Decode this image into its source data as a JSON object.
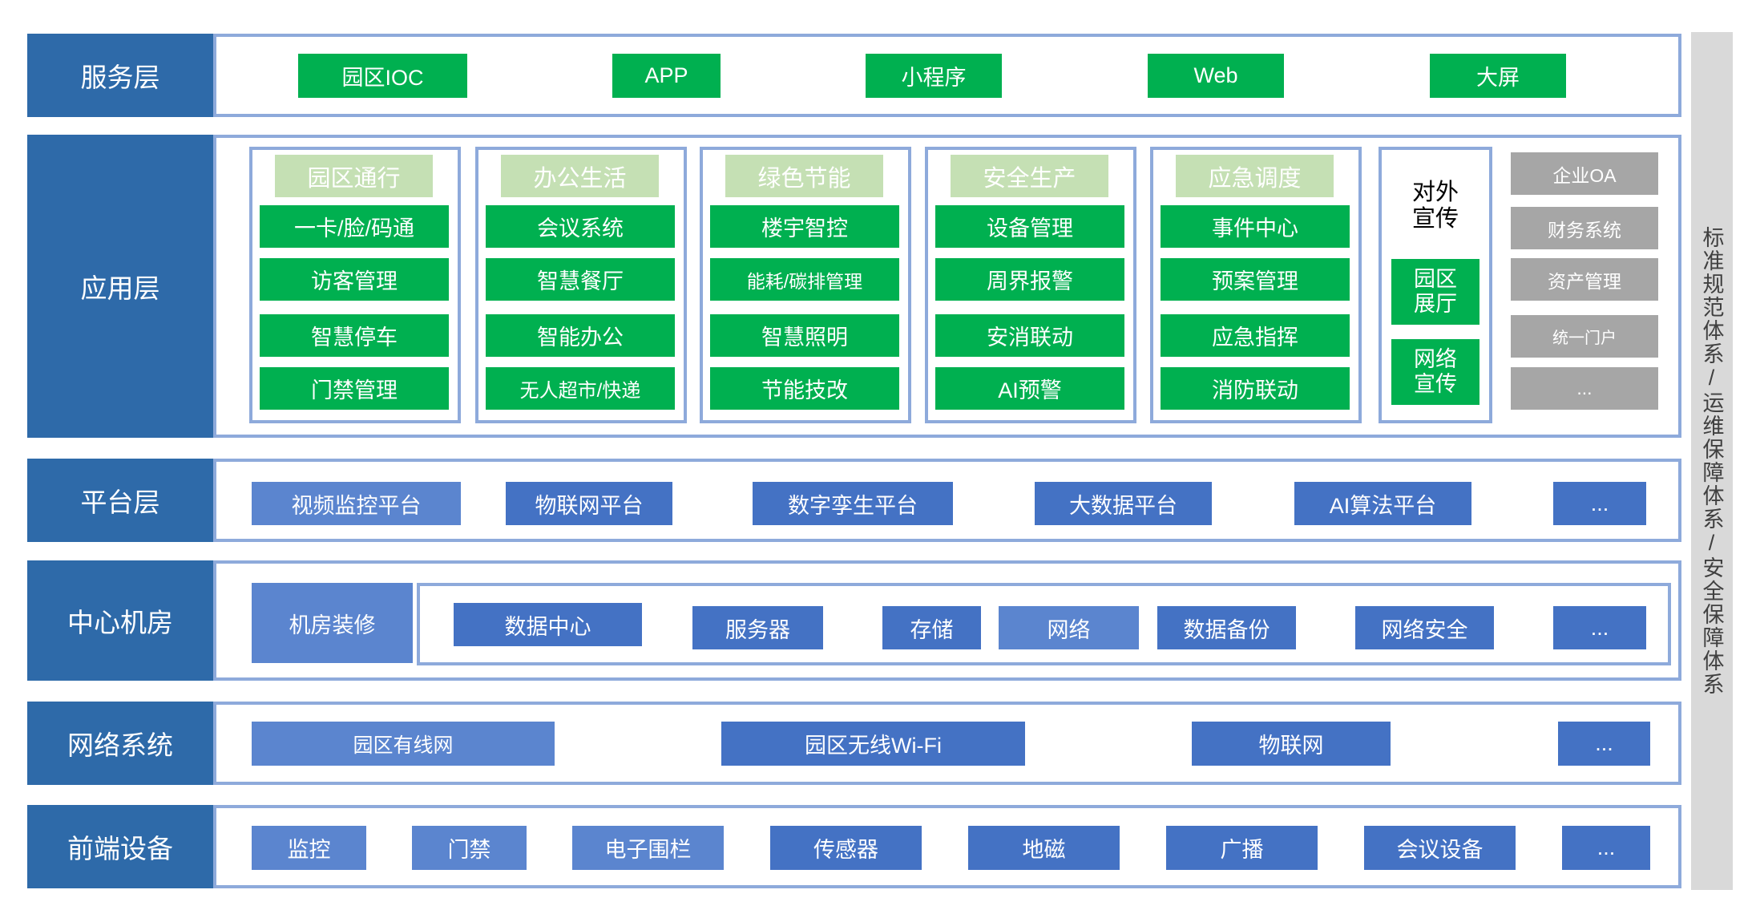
{
  "layers": {
    "service": "服务层",
    "application": "应用层",
    "platform": "平台层",
    "datacenter": "中心机房",
    "network": "网络系统",
    "frontend": "前端设备"
  },
  "service": [
    "园区IOC",
    "APP",
    "小程序",
    "Web",
    "大屏"
  ],
  "app_columns": [
    {
      "title": "园区通行",
      "items": [
        "一卡/脸/码通",
        "访客管理",
        "智慧停车",
        "门禁管理"
      ]
    },
    {
      "title": "办公生活",
      "items": [
        "会议系统",
        "智慧餐厅",
        "智能办公",
        "无人超市/快递"
      ]
    },
    {
      "title": "绿色节能",
      "items": [
        "楼宇智控",
        "能耗/碳排管理",
        "智慧照明",
        "节能技改"
      ]
    },
    {
      "title": "安全生产",
      "items": [
        "设备管理",
        "周界报警",
        "安消联动",
        "AI预警"
      ]
    },
    {
      "title": "应急调度",
      "items": [
        "事件中心",
        "预案管理",
        "应急指挥",
        "消防联动"
      ]
    }
  ],
  "publicity": {
    "title": "对外宣传",
    "items": [
      "园区展厅",
      "网络宣传"
    ]
  },
  "enterprise": [
    "企业OA",
    "财务系统",
    "资产管理",
    "统一门户",
    "..."
  ],
  "platform": [
    "视频监控平台",
    "物联网平台",
    "数字孪生平台",
    "大数据平台",
    "AI算法平台",
    "..."
  ],
  "datacenter": {
    "decoration": "机房装修",
    "items": [
      "数据中心",
      "服务器",
      "存储",
      "网络",
      "数据备份",
      "网络安全",
      "..."
    ]
  },
  "network": [
    "园区有线网",
    "园区无线Wi-Fi",
    "物联网",
    "..."
  ],
  "frontend": [
    "监控",
    "门禁",
    "电子围栏",
    "传感器",
    "地磁",
    "广播",
    "会议设备",
    "..."
  ],
  "side": "标准规范体系/运维保障体系/安全保障体系",
  "colors": {
    "layer_label": "#2e6aa9",
    "frame_border": "#8eaadb",
    "green": "#00b050",
    "light_green": "#c5e0b4",
    "gray": "#a6a6a6",
    "blue": "#4472c4",
    "side_band": "#d9d9d9"
  }
}
